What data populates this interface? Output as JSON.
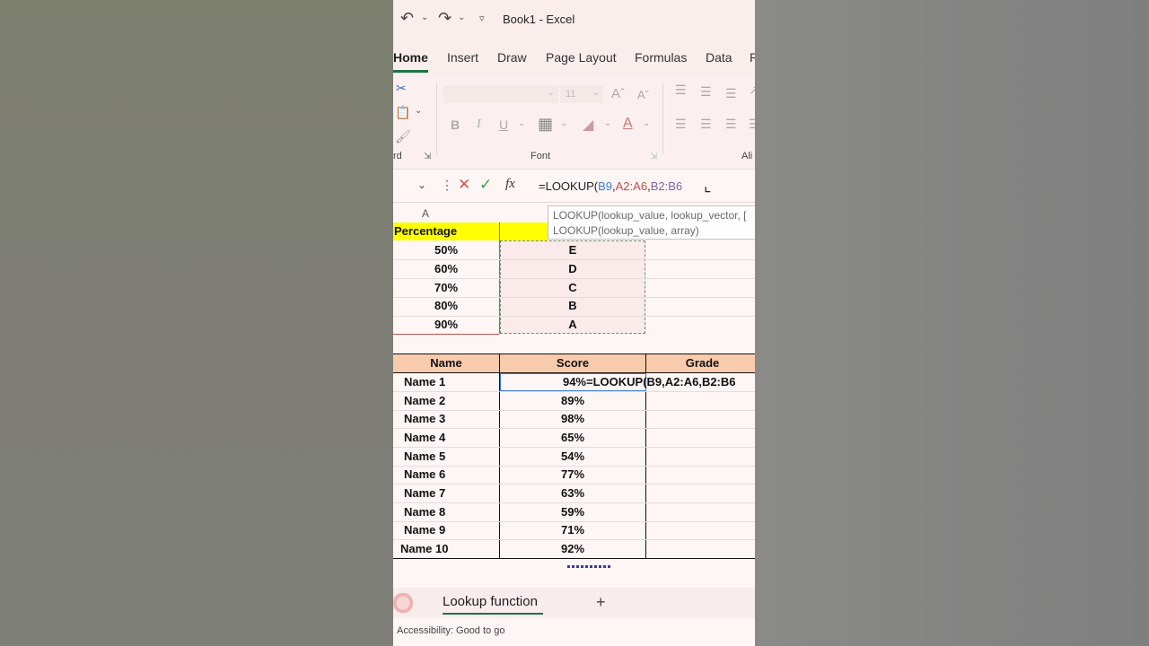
{
  "window": {
    "title": "Book1  -  Excel"
  },
  "ribbon_tabs": [
    "Home",
    "Insert",
    "Draw",
    "Page Layout",
    "Formulas",
    "Data",
    "R"
  ],
  "ribbon": {
    "font_size": "11",
    "font_group_label": "Font",
    "clipboard_label": "rd",
    "alignment_label": "Ali"
  },
  "formula_bar": {
    "fx": "fx",
    "formula_prefix": "=LOOKUP(",
    "arg1": "B9",
    "sep1": ",",
    "arg2": "A2:A6",
    "sep2": ",",
    "arg3": "B2:B6"
  },
  "columns": {
    "a": "A"
  },
  "tooltip": {
    "line1": "LOOKUP(lookup_value, lookup_vector, [",
    "line2": "LOOKUP(lookup_value, array)"
  },
  "lookup_table": {
    "header": "Percentage",
    "rows": [
      {
        "pct": "50%",
        "grade": "E"
      },
      {
        "pct": "60%",
        "grade": "D"
      },
      {
        "pct": "70%",
        "grade": "C"
      },
      {
        "pct": "80%",
        "grade": "B"
      },
      {
        "pct": "90%",
        "grade": "A"
      }
    ]
  },
  "score_table": {
    "headers": [
      "Name",
      "Score",
      "Grade"
    ],
    "editing_cell": "=LOOKUP(B9,A2:A6,B2:B6",
    "rows": [
      {
        "name": "Name 1",
        "score": "94%"
      },
      {
        "name": "Name 2",
        "score": "89%"
      },
      {
        "name": "Name 3",
        "score": "98%"
      },
      {
        "name": "Name 4",
        "score": "65%"
      },
      {
        "name": "Name 5",
        "score": "54%"
      },
      {
        "name": "Name 6",
        "score": "77%"
      },
      {
        "name": "Name 7",
        "score": "63%"
      },
      {
        "name": "Name 8",
        "score": "59%"
      },
      {
        "name": "Name 9",
        "score": "71%"
      },
      {
        "name": "Name 10",
        "score": "92%"
      }
    ]
  },
  "sheet_tab": "Lookup function",
  "add_sheet": "+",
  "status": "Accessibility: Good to go",
  "colors": {
    "header_yellow": "#ffff00",
    "header_peach": "#f8cbad",
    "accent_green": "#1e7145"
  }
}
